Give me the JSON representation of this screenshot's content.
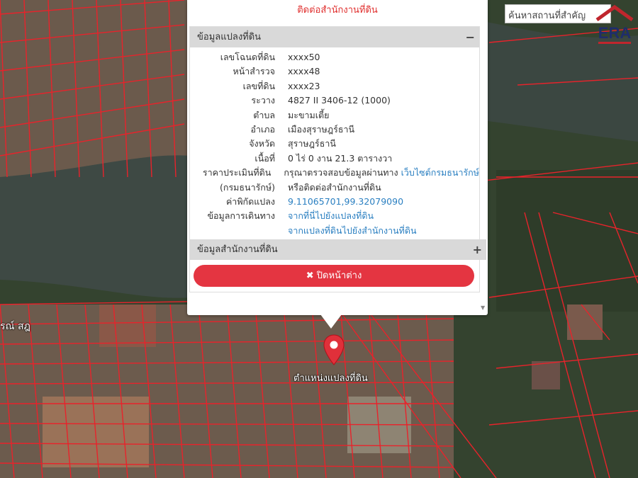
{
  "map": {
    "place_label": "รณ์ สฎ",
    "marker_label": "ตำแหน่งแปลงที่ดิน",
    "colors": {
      "parcel_line": "#e8232b",
      "water": "#3f4a45",
      "vegetation": "#2f3d2a",
      "roof": "#7a4a40"
    }
  },
  "search": {
    "placeholder": "ค้นหาสถานที่สำคัญ"
  },
  "logo": {
    "text": "ERA"
  },
  "popup": {
    "top_note": "ติดต่อสำนักงานที่ดิน",
    "section1": {
      "title": "ข้อมูลแปลงที่ดิน",
      "toggle": "−"
    },
    "rows": [
      {
        "label": "เลขโฉนดที่ดิน",
        "value": "xxxx50"
      },
      {
        "label": "หน้าสำรวจ",
        "value": "xxxx48"
      },
      {
        "label": "เลขที่ดิน",
        "value": "xxxx23"
      },
      {
        "label": "ระวาง",
        "value": "4827 II 3406-12 (1000)"
      },
      {
        "label": "ตำบล",
        "value": "มะขามเตี้ย"
      },
      {
        "label": "อำเภอ",
        "value": "เมืองสุราษฎร์ธานี"
      },
      {
        "label": "จังหวัด",
        "value": "สุราษฎร์ธานี"
      },
      {
        "label": "เนื้อที่",
        "value": "0 ไร่ 0 งาน 21.3 ตารางวา"
      }
    ],
    "price": {
      "label1": "ราคาประเมินที่ดิน",
      "label2": "(กรมธนารักษ์)",
      "text1": "กรุณาตรวจสอบข้อมูลผ่านทาง ",
      "link1": "เว็บไซต์กรมธนารักษ์",
      "text2": "หรือติดต่อสำนักงานที่ดิน"
    },
    "coords": {
      "label": "ค่าพิกัดแปลง",
      "value": "9.11065701,99.32079090"
    },
    "route": {
      "label": "ข้อมูลการเดินทาง",
      "link1": "จากที่นี่ไปยังแปลงที่ดิน",
      "link2": "จากแปลงที่ดินไปยังสำนักงานที่ดิน"
    },
    "section2": {
      "title": "ข้อมูลสำนักงานที่ดิน",
      "toggle": "+"
    },
    "close_button": {
      "icon": "✖",
      "label": "ปิดหน้าต่าง"
    }
  }
}
